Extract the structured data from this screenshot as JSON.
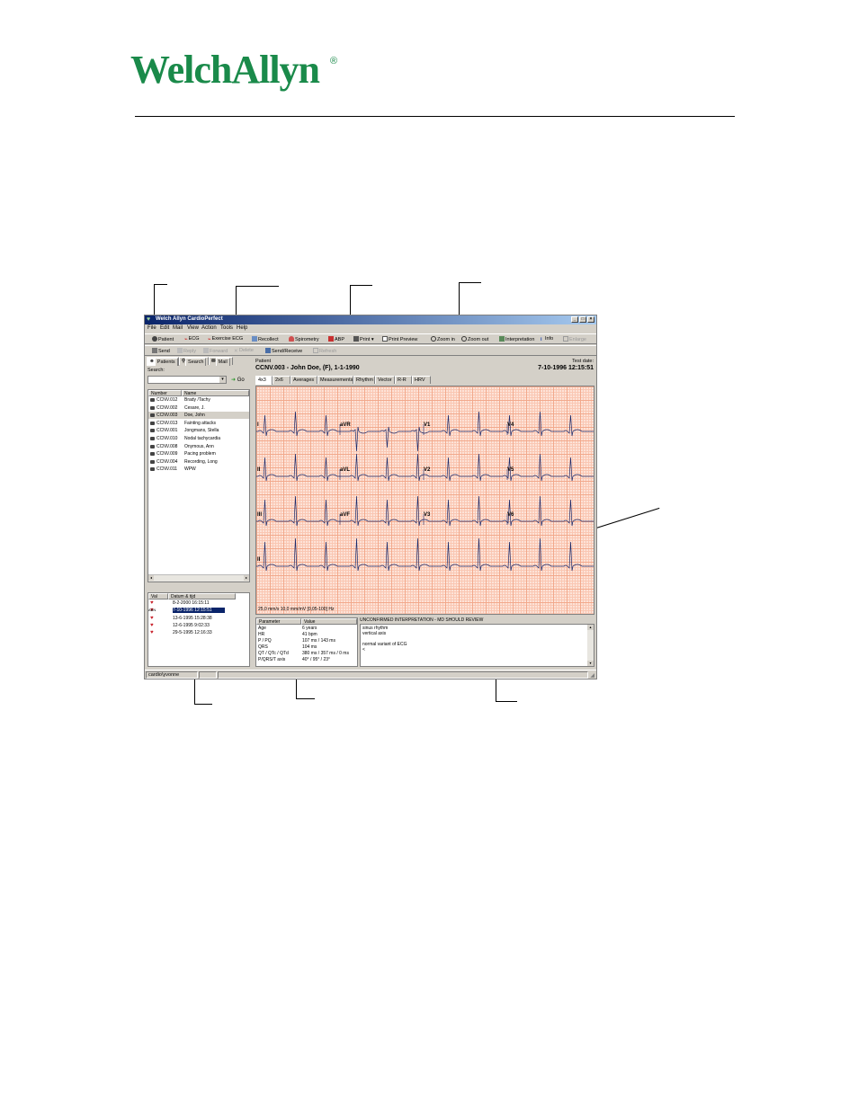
{
  "logo": {
    "text": "WelchAllyn",
    "reg": "®"
  },
  "window": {
    "title": "Welch Allyn CardioPerfect",
    "controls": [
      "_",
      "□",
      "×"
    ],
    "menu": [
      "File",
      "Edit",
      "Mail",
      "View",
      "Action",
      "Tools",
      "Help"
    ],
    "toolbar1": [
      {
        "label": "Patient",
        "icon": "patient-icon",
        "enabled": true
      },
      {
        "label": "ECG",
        "icon": "ecg-icon",
        "enabled": true
      },
      {
        "label": "Exercise ECG",
        "icon": "exercise-ecg-icon",
        "enabled": true
      },
      {
        "label": "Recollect",
        "icon": "recollect-icon",
        "enabled": true
      },
      {
        "label": "Spirometry",
        "icon": "lungs-icon",
        "enabled": true
      },
      {
        "label": "ABP",
        "icon": "abp-icon",
        "enabled": true
      },
      {
        "label": "Print",
        "icon": "printer-icon",
        "enabled": true
      },
      {
        "label": "Print Preview",
        "icon": "print-preview-icon",
        "enabled": true
      },
      {
        "label": "Zoom in",
        "icon": "zoom-in-icon",
        "enabled": true
      },
      {
        "label": "Zoom out",
        "icon": "zoom-out-icon",
        "enabled": true
      },
      {
        "label": "Interpretation",
        "icon": "interpretation-icon",
        "enabled": true
      },
      {
        "label": "Info",
        "icon": "info-icon",
        "enabled": true
      },
      {
        "label": "Enlarge",
        "icon": "enlarge-icon",
        "enabled": false
      }
    ],
    "toolbar2": [
      {
        "label": "Send",
        "icon": "send-icon",
        "enabled": true
      },
      {
        "label": "Reply",
        "icon": "reply-icon",
        "enabled": false
      },
      {
        "label": "Forward",
        "icon": "forward-icon",
        "enabled": false
      },
      {
        "label": "Delete",
        "icon": "delete-icon",
        "enabled": false
      },
      {
        "label": "Send/Receive",
        "icon": "send-receive-icon",
        "enabled": true
      },
      {
        "label": "Refresh",
        "icon": "refresh-icon",
        "enabled": false
      }
    ],
    "left": {
      "tabs": [
        "Patients",
        "Search",
        "Mail"
      ],
      "search_label": "Search:",
      "search_value": "",
      "go_label": "Go",
      "patient_headers": [
        "Number",
        "Name"
      ],
      "patients": [
        {
          "number": "CCNV.012",
          "name": "Brady /Tachy"
        },
        {
          "number": "CCNV.002",
          "name": "Cesare, J."
        },
        {
          "number": "CCNV.003",
          "name": "Doe, John",
          "selected": true
        },
        {
          "number": "CCNV.013",
          "name": "Fainting attacks"
        },
        {
          "number": "CCNV.001",
          "name": "Jongmans, Stella"
        },
        {
          "number": "CCNV.010",
          "name": "Nodal tachycardia"
        },
        {
          "number": "CCNV.008",
          "name": "Onymous, Ann"
        },
        {
          "number": "CCNV.009",
          "name": "Pacing problem"
        },
        {
          "number": "CCNV.004",
          "name": "Recording, Long"
        },
        {
          "number": "CCNV.011",
          "name": "WPW"
        }
      ],
      "exam_headers": [
        "Val",
        "Datum & tijd"
      ],
      "exams": [
        {
          "val": "",
          "datetime": "8-2-2000 16:15:11"
        },
        {
          "val": "ABN",
          "datetime": "7-10-1996 12:15:51",
          "selected": true
        },
        {
          "val": "",
          "datetime": "13-6-1995 15:28:38"
        },
        {
          "val": "",
          "datetime": "12-6-1995 9:02:33"
        },
        {
          "val": "",
          "datetime": "29-5-1995 12:16:33"
        }
      ]
    },
    "right": {
      "patient_label": "Patient",
      "patient_value": "CCNV.003 - John Doe, (F), 1-1-1990",
      "testdate_label": "Test date:",
      "testdate_value": "7-10-1996 12:15:51",
      "tabs": [
        "4x3",
        "2x6",
        "Averages",
        "Measurements",
        "Rhythm",
        "Vector",
        "R-R",
        "HRV"
      ],
      "leads": [
        "I",
        "aVR",
        "V1",
        "V4",
        "II",
        "aVL",
        "V2",
        "V5",
        "III",
        "aVF",
        "V3",
        "V6",
        "II"
      ],
      "ecg_footer": "25,0 mm/s 10,0 mm/mV [0,05-100] Hz",
      "param_headers": [
        "Parameter",
        "Value"
      ],
      "params": [
        {
          "name": "Age",
          "value": "6 years"
        },
        {
          "name": "HR",
          "value": "41 bpm"
        },
        {
          "name": "P / PQ",
          "value": "107 ms / 143 ms"
        },
        {
          "name": "QRS",
          "value": "104 ms"
        },
        {
          "name": "QT / QTc / QTd",
          "value": "380 ms / 357 ms / 0 ms"
        },
        {
          "name": "P/QRS/T axis",
          "value": "40° / 95° / 23°"
        }
      ],
      "interp_header": "UNCONFIRMED INTERPRETATION - MD SHOULD REVIEW",
      "interp_lines": [
        "sinus rhythm",
        "vertical axis",
        "",
        "normal variant of ECG",
        "<"
      ]
    },
    "statusbar": "cardio\\yvonne"
  },
  "colors": {
    "brand": "#1a8a4a",
    "ecg_grid": "#f2a98c",
    "ecg_trace": "#1b2a6b",
    "selection": "#0a246a"
  }
}
